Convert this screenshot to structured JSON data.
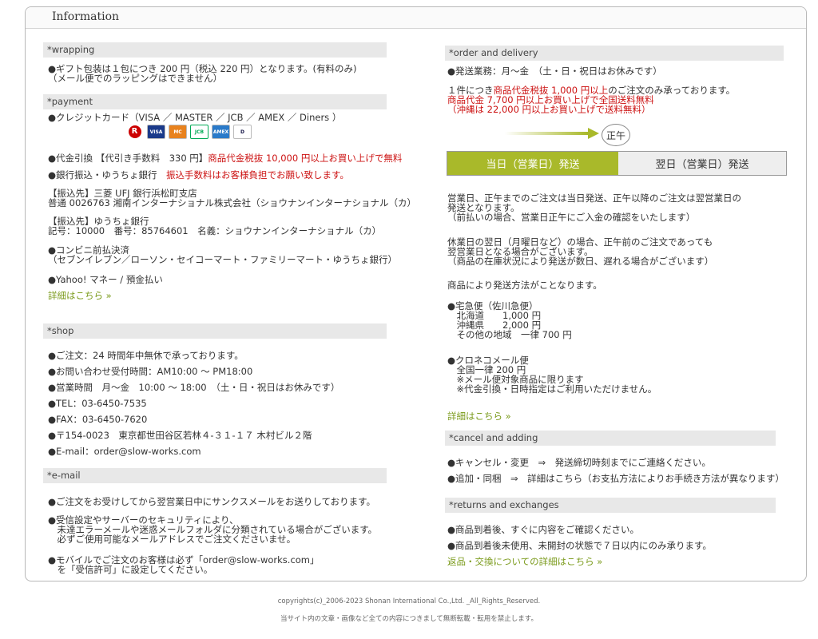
{
  "header": {
    "title": "Information"
  },
  "wrapping": {
    "heading": "*wrapping",
    "lines": [
      "●ギフト包装は１包につき 200 円（税込 220 円）となります。(有料のみ)",
      "（メール便でのラッピングはできません）"
    ]
  },
  "payment": {
    "heading": "*payment",
    "card": "●クレジットカード（VISA ／ MASTER ／ JCB ／ AMEX ／ Diners ）",
    "badges": [
      "R",
      "VISA",
      "MC",
      "JCB",
      "AMEX",
      "D"
    ],
    "cod_a": "●代金引換 【代引き手数料　330 円】",
    "cod_b": "商品代金税抜 10,000 円以上お買い上げで無料",
    "bank_a": "●銀行振込・ゆうちょ銀行",
    "bank_b": "振込手数料はお客様負担でお願い致します。",
    "ufj1": "【振込先】三菱 UFJ 銀行浜松町支店",
    "ufj2": "普通 0026763 湘南インターナショナル株式会社（ショウナンインターナショナル（カ）",
    "yu1": "【振込先】ゆうちょ銀行",
    "yu2": "記号：10000　番号：85764601　名義：ショウナンインターナショナル（カ）",
    "cvs1": "●コンビニ前払決済",
    "cvs2": "（セブンイレブン／ローソン・セイコーマート・ファミリーマート・ゆうちょ銀行）",
    "yahoo": "●Yahoo! マネー / 預金払い",
    "more": "詳細はこちら »"
  },
  "shop": {
    "heading": "*shop",
    "items": [
      "●ご注文：24 時間年中無休で承っております。",
      "●お問い合わせ受付時間：AM10:00 ～ PM18:00",
      "●営業時間　月～金　10:00 ～ 18:00　（土・日・祝日はお休みです）",
      "●TEL：03-6450-7535",
      "●FAX：03-6450-7620",
      "●〒154-0023　東京都世田谷区若林４-３１-１７ 木村ビル２階",
      "●E-mail：order@slow-works.com"
    ]
  },
  "email": {
    "heading": "*e-mail",
    "p1": "●ご注文をお受けしてから翌営業日中にサンクスメールをお送りしております。",
    "p2": [
      "●受信設定やサーバーのセキュリティにより、",
      "　未達エラーメールや迷惑メールフォルダに分類されている場合がございます。",
      "　必ずご使用可能なメールアドレスでご注文くださいませ。"
    ],
    "p3": [
      "●モバイルでご注文のお客様は必ず「order@slow-works.com」",
      "　を「受信許可」に設定してください。"
    ]
  },
  "order": {
    "heading": "*order and delivery",
    "hours": "●発送業務：月～金　（土・日・祝日はお休みです）",
    "min_a": "１件につき",
    "min_b": "商品代金税抜 1,000 円以上",
    "min_c": "のご注文のみ承っております。",
    "free1": "商品代金 7,700 円以上お買い上げで全国送料無料",
    "free2": "（沖縄は 22,000 円以上お買い上げで送料無料）",
    "noon": "正午",
    "tab_today": "当日（営業日）発送",
    "tab_next": "翌日（営業日）発送",
    "desc1": [
      "営業日、正午までのご注文は当日発送、正午以降のご注文は翌営業日の",
      "発送となります。",
      "（前払いの場合、営業日正午にご入金の確認をいたします）"
    ],
    "desc2": [
      "休業日の翌日（月曜日など）の場合、正午前のご注文であっても",
      "翌営業日となる場合がございます。",
      "（商品の在庫状況により発送が数日、遅れる場合がございます）"
    ],
    "method": "商品により発送方法がことなります。",
    "express": [
      "●宅急便（佐川急便）",
      "　北海道　　1,000 円",
      "　沖縄県　　2,000 円",
      "　その他の地域　一律 700 円"
    ],
    "mail": [
      "●クロネコメール便",
      "　全国一律 200 円",
      "　※メール便対象商品に限ります",
      "　※代金引換・日時指定はご利用いただけません。"
    ],
    "more": "詳細はこちら »"
  },
  "cancel": {
    "heading": "*cancel and adding",
    "l1": "●キャンセル・変更　⇒　発送締切時刻までにご連絡ください。",
    "l2": "●追加・同梱　⇒　詳細はこちら（お支払方法によりお手続き方法が異なります）"
  },
  "returns": {
    "heading": "*returns and exchanges",
    "l1": "●商品到着後、すぐに内容をご確認ください。",
    "l2": "●商品到着後未使用、未開封の状態で７日以内にのみ承ります。",
    "more": "返品・交換についての詳細はこちら »"
  },
  "footer": {
    "copyright": "copyrights(c)_2006-2023 Shonan International Co.,Ltd. _All_Rights_Reserved.",
    "notice": "当サイト内の文章・画像など全ての内容につきまして無断転載・転用を禁止します。"
  },
  "colors": {
    "accent_green": "#a9b92a",
    "link_green": "#7a9a1a",
    "red": "#cc1111"
  }
}
